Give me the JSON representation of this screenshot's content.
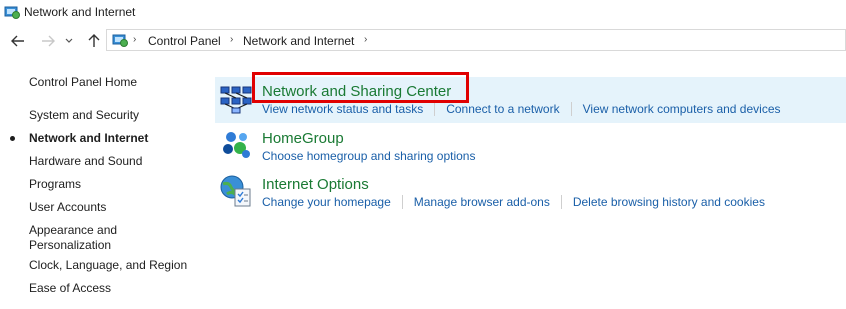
{
  "window": {
    "title": "Network and Internet"
  },
  "navigation": {
    "breadcrumbs": [
      "Control Panel",
      "Network and Internet"
    ]
  },
  "sidebar": {
    "items": [
      {
        "label": "Control Panel Home",
        "current": false
      },
      {
        "label": "System and Security",
        "current": false
      },
      {
        "label": "Network and Internet",
        "current": true
      },
      {
        "label": "Hardware and Sound",
        "current": false
      },
      {
        "label": "Programs",
        "current": false
      },
      {
        "label": "User Accounts",
        "current": false
      },
      {
        "label": "Appearance and\nPersonalization",
        "current": false
      },
      {
        "label": "Clock, Language, and Region",
        "current": false
      },
      {
        "label": "Ease of Access",
        "current": false
      }
    ]
  },
  "main": {
    "sections": [
      {
        "title": "Network and Sharing Center",
        "icon": "network-sharing-icon",
        "links": [
          "View network status and tasks",
          "Connect to a network",
          "View network computers and devices"
        ]
      },
      {
        "title": "HomeGroup",
        "icon": "homegroup-icon",
        "links": [
          "Choose homegroup and sharing options"
        ]
      },
      {
        "title": "Internet Options",
        "icon": "internet-options-icon",
        "links": [
          "Change your homepage",
          "Manage browser add-ons",
          "Delete browsing history and cookies"
        ]
      }
    ]
  },
  "colors": {
    "accent_title": "#1a7a34",
    "link": "#1a5fa8",
    "hover_bg": "#e5f3fb",
    "highlight": "#e00000"
  }
}
